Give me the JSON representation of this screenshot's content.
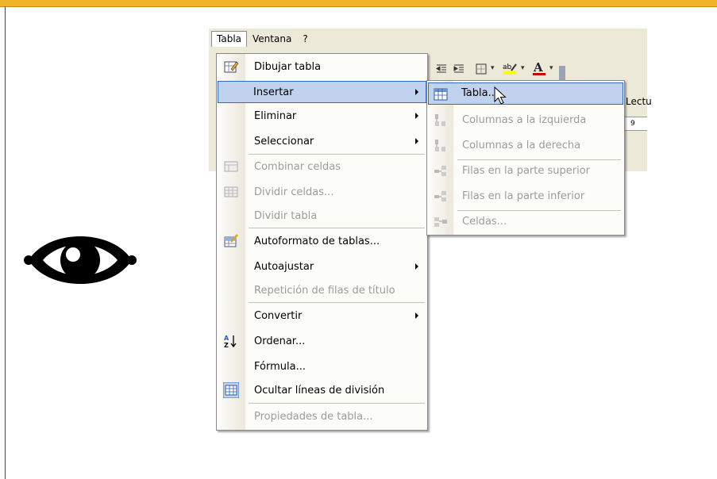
{
  "menubar": {
    "tabla": "Tabla",
    "ventana": "Ventana",
    "help": "?"
  },
  "word_partial": {
    "lectura": "Lectu",
    "ruler_num": "9"
  },
  "menu": {
    "items": [
      {
        "label": "Dibujar tabla",
        "icon": "pencil-table-icon",
        "disabled": false
      },
      {
        "label": "Insertar",
        "icon": "",
        "disabled": false,
        "submenu": true,
        "selected": true
      },
      {
        "label": "Eliminar",
        "icon": "",
        "disabled": false,
        "submenu": true
      },
      {
        "label": "Seleccionar",
        "icon": "",
        "disabled": false,
        "submenu": true
      },
      {
        "label": "Combinar celdas",
        "icon": "merge-cells-icon",
        "disabled": true
      },
      {
        "label": "Dividir celdas...",
        "icon": "split-cells-icon",
        "disabled": true
      },
      {
        "label": "Dividir tabla",
        "icon": "",
        "disabled": true
      },
      {
        "label": "Autoformato de tablas...",
        "icon": "autoformat-icon",
        "disabled": false
      },
      {
        "label": "Autoajustar",
        "icon": "",
        "disabled": false,
        "submenu": true
      },
      {
        "label": "Repetición de filas de título",
        "icon": "",
        "disabled": true
      },
      {
        "label": "Convertir",
        "icon": "",
        "disabled": false,
        "submenu": true
      },
      {
        "label": "Ordenar...",
        "icon": "sort-az-icon",
        "disabled": false
      },
      {
        "label": "Fórmula...",
        "icon": "",
        "disabled": false
      },
      {
        "label": "Ocultar líneas de división",
        "icon": "gridlines-icon",
        "disabled": false
      },
      {
        "label": "Propiedades de tabla...",
        "icon": "",
        "disabled": true
      }
    ]
  },
  "submenu": {
    "items": [
      {
        "label": "Tabla...",
        "icon": "table-grid-icon",
        "disabled": false,
        "selected": true
      },
      {
        "label": "Columnas a la izquierda",
        "icon": "insert-col-left-icon",
        "disabled": true
      },
      {
        "label": "Columnas a la derecha",
        "icon": "insert-col-right-icon",
        "disabled": true
      },
      {
        "label": "Filas en la parte superior",
        "icon": "insert-row-above-icon",
        "disabled": true
      },
      {
        "label": "Filas en la parte inferior",
        "icon": "insert-row-below-icon",
        "disabled": true
      },
      {
        "label": "Celdas...",
        "icon": "insert-cells-icon",
        "disabled": true
      }
    ]
  },
  "colors": {
    "accent_bar": "#f0b429",
    "highlight": "#c1d2ee",
    "highlight_border": "#316ac5"
  }
}
